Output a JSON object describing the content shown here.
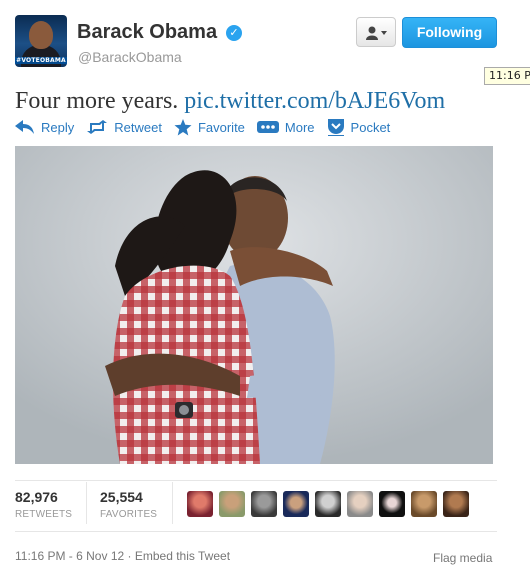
{
  "tweet": {
    "author": {
      "name": "Barack Obama",
      "handle": "@BarackObama",
      "avatar_tag": "#VOTEOBAMA",
      "verified": true
    },
    "follow_label": "Following",
    "tooltip_time": "11:16 P",
    "text": "Four more years.",
    "link": "pic.twitter.com/bAJE6Vom",
    "actions": [
      {
        "label": "Reply",
        "icon": "reply-icon"
      },
      {
        "label": "Retweet",
        "icon": "retweet-icon"
      },
      {
        "label": "Favorite",
        "icon": "star-icon"
      },
      {
        "label": "More",
        "icon": "more-icon"
      },
      {
        "label": "Pocket",
        "icon": "pocket-icon"
      }
    ],
    "stats": {
      "retweets_count": "82,976",
      "retweets_label": "RETWEETS",
      "favorites_count": "25,554",
      "favorites_label": "FAVORITES"
    },
    "favoriter_avatars": [
      "pink-red",
      "tan",
      "gray",
      "navy",
      "dark-gray",
      "light-gray",
      "black",
      "sepia",
      "warm-brown"
    ],
    "timestamp": "11:16 PM - 6 Nov 12",
    "embed_label": "Embed this Tweet",
    "flag_label": "Flag media",
    "colors": {
      "follow_button": "#1c95e0",
      "link": "#2a7ac0",
      "verified": "#2aa3ef"
    }
  }
}
